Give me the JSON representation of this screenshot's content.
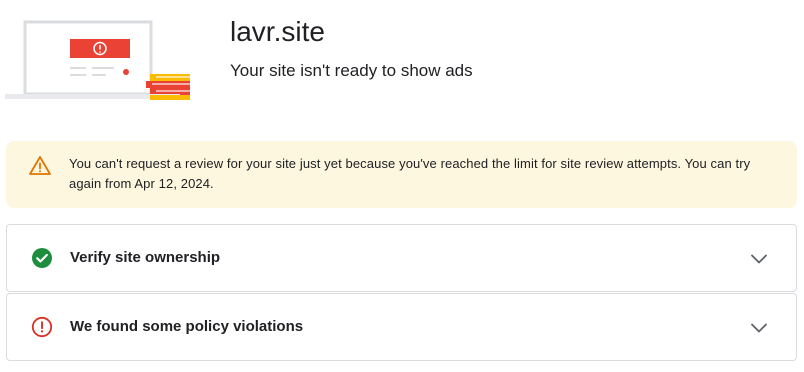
{
  "site": {
    "name": "lavr.site",
    "status_text": "Your site isn't ready to show ads"
  },
  "illustration": {
    "icon": "laptop-with-error-and-books-illustration",
    "accent_red": "#ea4335",
    "accent_yellow": "#fbbc04"
  },
  "banner": {
    "icon": "warning-triangle-icon",
    "text": "You can't request a review for your site just yet because you've reached the limit for site review attempts. You can try again from Apr 12, 2024.",
    "background": "#fef7e0",
    "icon_color": "#e37400"
  },
  "tasks": [
    {
      "title": "Verify site ownership",
      "status": "complete",
      "icon": "check-circle-icon",
      "icon_color": "#1e8e3e",
      "expand_icon": "chevron-down-icon"
    },
    {
      "title": "We found some policy violations",
      "status": "error",
      "icon": "error-circle-icon",
      "icon_color": "#d93025",
      "expand_icon": "chevron-down-icon"
    }
  ]
}
